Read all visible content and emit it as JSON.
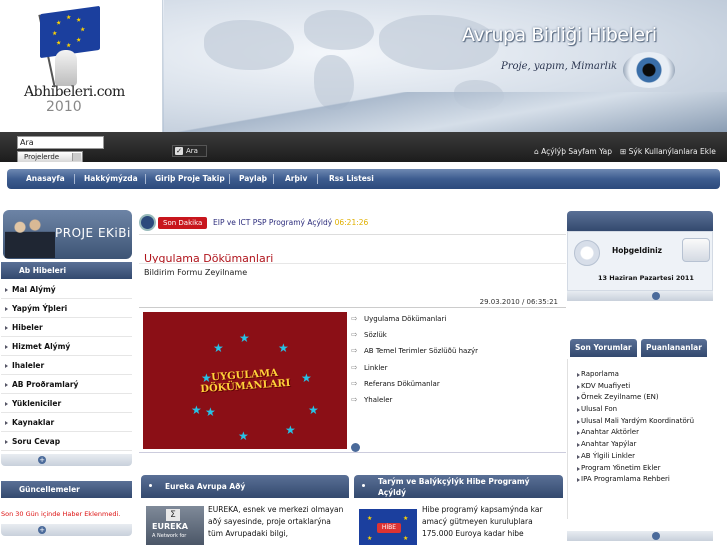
{
  "logo": {
    "site_text": "Abhibeleri.com",
    "year": "2010"
  },
  "header": {
    "title": "Avrupa Birliği Hibeleri",
    "slogan": "Proje, yapım, Mimarlık"
  },
  "toolbar": {
    "search_value": "Ara",
    "search_scope": "Projelerde",
    "search_button": "Ara",
    "homepage_link": "Açýlýþ Sayfam Yap",
    "favorites_link": "Sýk Kullanýlanlara Ekle"
  },
  "nav": {
    "items": [
      "Anasayfa",
      "Hakkýmýzda",
      "Giriþ Proje Takip",
      "Paylaþ",
      "Arþiv",
      "Rss Listesi"
    ]
  },
  "left": {
    "team_banner": "PROJE EKiBi",
    "section_title": "Ab Hibeleri",
    "items": [
      "Mal Alýmý",
      "Yapým Ýþleri",
      "Hibeler",
      "Hizmet Alýmý",
      "Ihaleler",
      "AB Proðramlarý",
      "Yükleniciler",
      "Kaynaklar",
      "Soru Cevap"
    ],
    "news_title": "Güncellemeler",
    "news_note": "Son 30 Gün içinde Haber Eklenmedi."
  },
  "ticker": {
    "tag": "Son Dakika",
    "text": "EIP ve ICT PSP Programý Açýldý",
    "time": "06:21:26"
  },
  "document": {
    "title": "Uygulama Dökümanlari",
    "subtitle": "Bildirim Formu Zeyilname",
    "date": "29.03.2010 / 06:35:21",
    "image_label": "UYGULAMA DÖKÜMANLARI",
    "links": [
      "Uygulama Dökümanlari",
      "Sözlük",
      "AB Temel Terimler Sözlüðü hazýr",
      "Linkler",
      "Referans Dökümanlar",
      "Yhaleler"
    ]
  },
  "news": [
    {
      "title": "Eureka Avrupa Aðý",
      "image_label": "EUREKA",
      "image_sub": "A Network for",
      "text": "EUREKA, esnek ve merkezi olmayan aðý sayesinde, proje ortaklarýna tüm Avrupadaki bilgi,"
    },
    {
      "title": "Tarým ve Balýkçýlýk Hibe Programý Açýldý",
      "image_label": "HİBE",
      "text": "Hibe programý kapsamýnda kar amacý gütmeyen kuruluþlara 175.000 Euroya kadar hibe"
    }
  ],
  "right": {
    "welcome": "Hoþgeldiniz",
    "date": "13 Haziran Pazartesi 2011",
    "tabs": [
      "Son Yorumlar",
      "Puanlananlar"
    ],
    "links": [
      "Raporlama",
      "KDV Muafiyeti",
      "Örnek Zeyilname (EN)",
      "Ulusal Fon",
      "Ulusal Mali Yardým Koordinatörü",
      "Anahtar Aktörler",
      "Anahtar Yapýlar",
      "AB Ýlgili Linkler",
      "Program Yönetim Ekler",
      "IPA Programlama Rehberi"
    ]
  },
  "colors": {
    "brand": "#33496e",
    "accent_red": "#c8161d",
    "title_red": "#b0141c",
    "eu_blue": "#1b3f9e"
  }
}
